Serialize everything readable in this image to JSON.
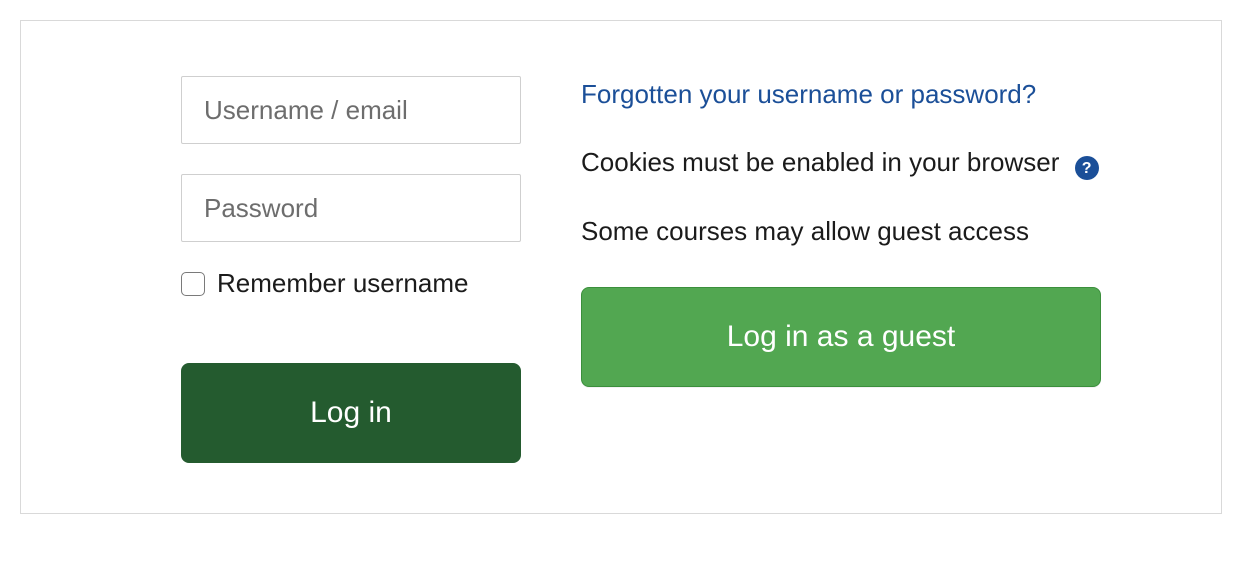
{
  "form": {
    "username_placeholder": "Username / email",
    "password_placeholder": "Password",
    "remember_label": "Remember username",
    "login_button": "Log in"
  },
  "aside": {
    "forgot_link": "Forgotten your username or password?",
    "cookies_notice": "Cookies must be enabled in your browser",
    "help_icon_glyph": "?",
    "guest_notice": "Some courses may allow guest access",
    "guest_button": "Log in as a guest"
  }
}
